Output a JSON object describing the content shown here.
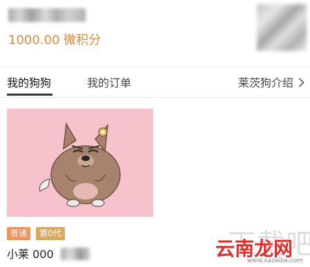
{
  "header": {
    "points": "1000.00 微积分"
  },
  "tabs": [
    {
      "label": "我的狗狗",
      "active": true
    },
    {
      "label": "我的订单",
      "active": false
    },
    {
      "label": "莱茨狗介绍",
      "active": false
    }
  ],
  "tab_intro_arrow": "chevron-right-icon",
  "dog": {
    "badge_rarity": "普通",
    "badge_generation": "第0代",
    "name": "小莱 000"
  },
  "watermark": {
    "big": "下载吧",
    "brand": "云南龙网",
    "url": "www.xazaiba.com"
  },
  "colors": {
    "points": "#e08a3c",
    "card_bg": "#f7c2cc",
    "badge_normal": "#ef9460",
    "badge_gen": "#d9a961",
    "watermark_brand": "#e52a2a"
  }
}
